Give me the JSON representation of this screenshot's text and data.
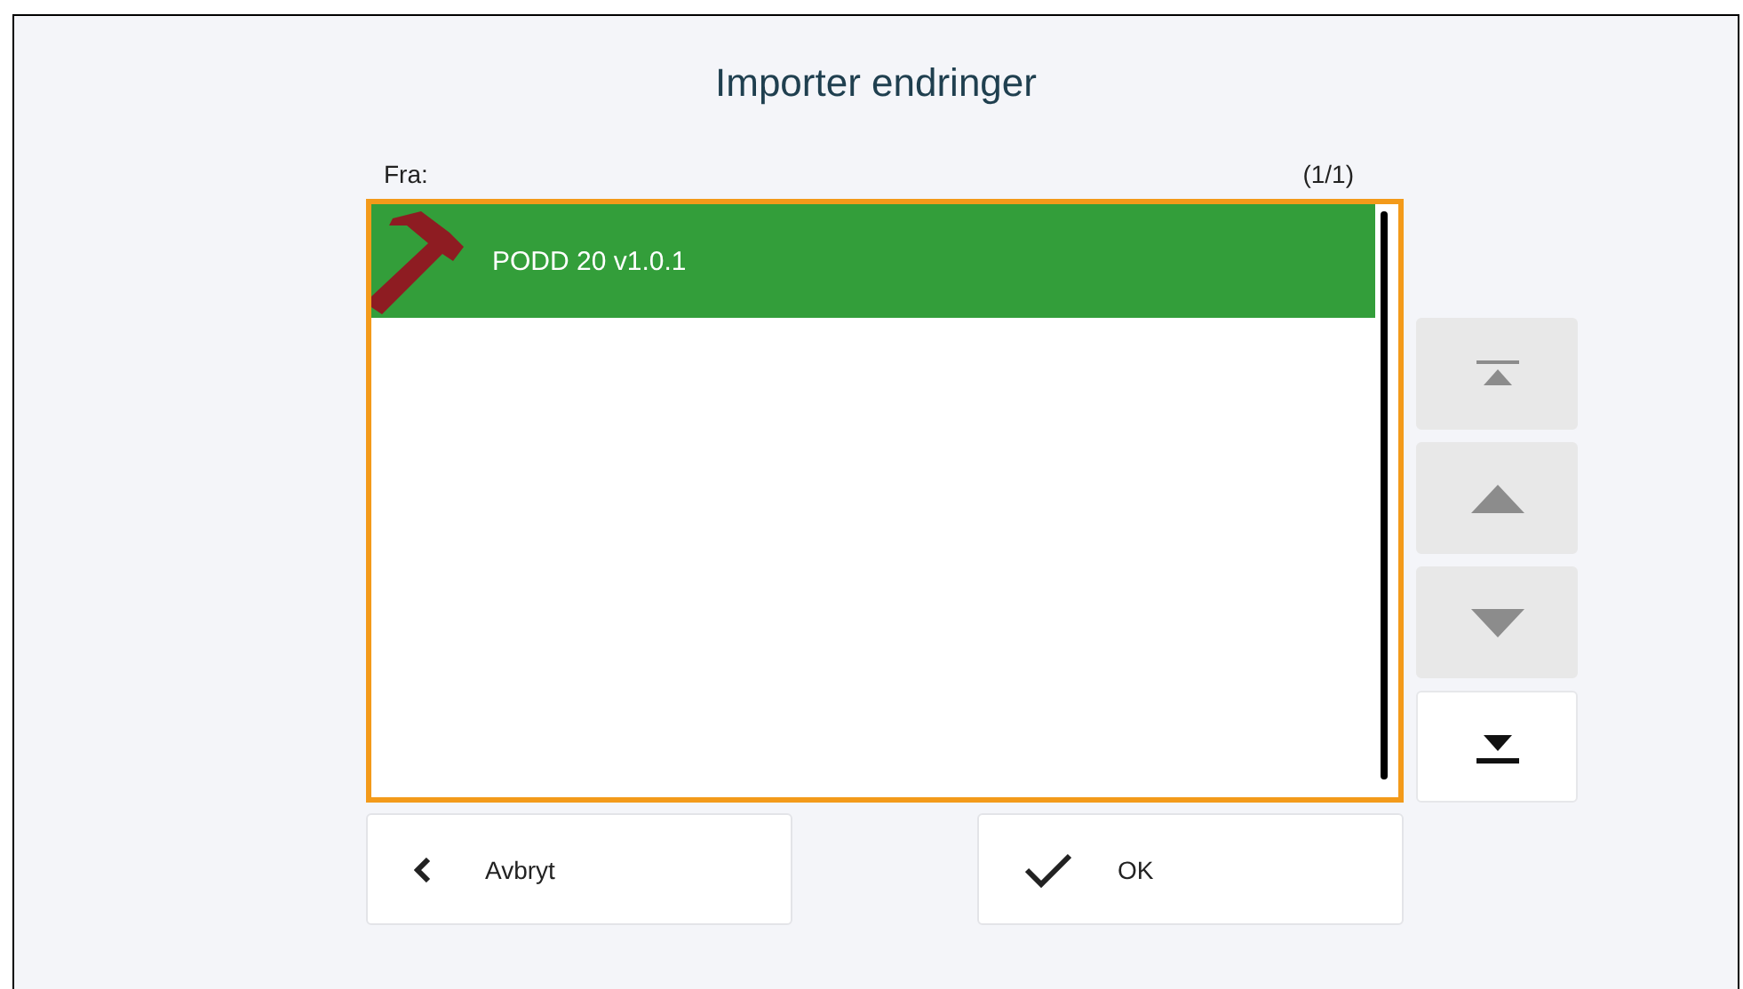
{
  "title": "Importer endringer",
  "source_label": "Fra:",
  "page_counter": "(1/1)",
  "list": {
    "items": [
      {
        "label": "PODD 20 v1.0.1",
        "selected": true
      }
    ]
  },
  "scroll_buttons": [
    {
      "kind": "top",
      "disabled": true
    },
    {
      "kind": "up",
      "disabled": true
    },
    {
      "kind": "down",
      "disabled": true
    },
    {
      "kind": "bottom",
      "disabled": false
    }
  ],
  "buttons": [
    {
      "kind": "back",
      "label": "Avbryt"
    },
    {
      "kind": "ok",
      "label": "OK"
    }
  ]
}
